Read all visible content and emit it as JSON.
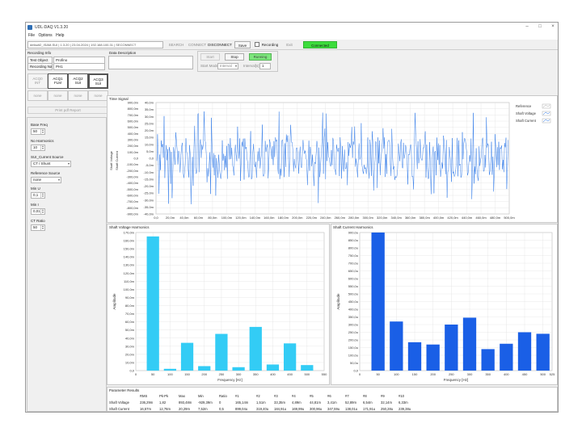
{
  "window": {
    "title": "UDL-DAQ V1.3.20"
  },
  "menu": [
    "File",
    "Options",
    "Help"
  ],
  "toolbar": {
    "device": "default2_ISAM-SUI | 1.3.20 | 23.04.2024 | 192.168.100.31 | SECONNECT",
    "search": "SEARCH",
    "connect": "CONNECT",
    "disconnect": "DISCONNECT",
    "save": "Save",
    "recording": "Recording",
    "exit": "Exit",
    "status": "Connected",
    "status_color": "#3cdc3c"
  },
  "recording_info": {
    "title": "Recording Info",
    "rows": [
      {
        "label": "Test Object",
        "value": "Profino"
      },
      {
        "label": "Recording Name",
        "value": "PH1"
      }
    ]
  },
  "data_description": {
    "title": "Data Description"
  },
  "controls": {
    "start": "Start",
    "stop": "Stop",
    "running": "Running",
    "start_mode_label": "Start Mode",
    "start_mode_value": "Interval",
    "interval_label": "Interval[s]",
    "interval_value": "1"
  },
  "acq_buttons": [
    {
      "line1": "ACQ0",
      "line2": "INT",
      "active": false
    },
    {
      "line1": "ACQ1",
      "line2": "FLM",
      "active": true
    },
    {
      "line1": "ACQ2",
      "line2": "SUI",
      "active": true
    },
    {
      "line1": "ACQ3",
      "line2": "SUI",
      "active": true
    }
  ],
  "acq_none": [
    "none",
    "none",
    "none",
    "none"
  ],
  "print_report": "Print pdf Report",
  "settings": {
    "base_freq_label": "Base Freq",
    "base_freq": "50",
    "no_harmonics_label": "No Harmonics",
    "no_harmonics": "10",
    "sui_source_label": "SUI_Current Source",
    "sui_source": "CT / Shunt",
    "ref_source_label": "Reference Source",
    "ref_source": "none",
    "min_u_label": "Min U",
    "min_u": "0,1",
    "min_i_label": "Min I",
    "min_i": "0,01",
    "ct_ratio_label": "CT Ratio",
    "ct_ratio": "50"
  },
  "time_signal": {
    "title": "Time Signal",
    "ylabel_left": "Shaft Voltage",
    "ylabel_right": "Shaft Current",
    "left_ticks": [
      "900,0m",
      "800,0m",
      "700,0m",
      "600,0m",
      "500,0m",
      "400,0m",
      "300,0m",
      "200,0m",
      "100,0m",
      "0,0",
      "-100,0m",
      "-200,0m",
      "-300,0m",
      "-400,0m",
      "-500,0m",
      "-600,0m",
      "-700,0m",
      "-800,0m",
      "-900,0m"
    ],
    "right_ticks": [
      "40,0m",
      "35,0m",
      "30,0m",
      "25,0m",
      "20,0m",
      "15,0m",
      "10,0m",
      "5,0m",
      "0,0",
      "-5,0m",
      "-10,0m",
      "-15,0m",
      "-20,0m",
      "-25,0m",
      "-30,0m",
      "-35,0m",
      "-40,0m"
    ],
    "x_ticks": [
      "0,0",
      "20,0m",
      "40,0m",
      "60,0m",
      "80,0m",
      "100,0m",
      "120,0m",
      "140,0m",
      "160,0m",
      "180,0m",
      "200,0m",
      "220,0m",
      "240,0m",
      "260,0m",
      "280,0m",
      "300,0m",
      "320,0m",
      "340,0m",
      "360,0m",
      "380,0m",
      "400,0m",
      "420,0m",
      "440,0m",
      "460,0m",
      "480,0m",
      "500,0m"
    ],
    "legend": [
      "Reference",
      "Shaft Voltage",
      "Shaft Current"
    ],
    "line_color": "#1e6ee6"
  },
  "voltage_harmonics": {
    "title": "Shaft Voltage Harmonics",
    "ylabel": "Amplitude",
    "xlabel": "Frequency [Hz]",
    "y_ticks": [
      "170,0m",
      "160,0m",
      "150,0m",
      "140,0m",
      "130,0m",
      "120,0m",
      "110,0m",
      "100,0m",
      "90,0m",
      "80,0m",
      "70,0m",
      "60,0m",
      "50,0m",
      "40,0m",
      "30,0m",
      "20,0m",
      "10,0m",
      "0,0"
    ],
    "x_ticks": [
      "0",
      "50",
      "100",
      "150",
      "200",
      "250",
      "300",
      "350",
      "400",
      "450",
      "500",
      "550"
    ],
    "bar_color": "#33ccf5"
  },
  "current_harmonics": {
    "title": "Shaft Current Harmonics",
    "ylabel": "Amplitude",
    "xlabel": "Frequency [Hz]",
    "y_ticks": [
      "900,0u",
      "850,0u",
      "800,0u",
      "750,0u",
      "700,0u",
      "650,0u",
      "600,0u",
      "550,0u",
      "500,0u",
      "450,0u",
      "400,0u",
      "350,0u",
      "300,0u",
      "250,0u",
      "200,0u",
      "150,0u",
      "100,0u",
      "50,0u",
      "0,0"
    ],
    "x_ticks": [
      "0",
      "50",
      "100",
      "150",
      "200",
      "250",
      "300",
      "350",
      "400",
      "450",
      "500",
      "525"
    ],
    "bar_color": "#1a5fe6"
  },
  "chart_data": [
    {
      "type": "bar",
      "title": "Shaft Voltage Harmonics",
      "xlabel": "Frequency [Hz]",
      "ylabel": "Amplitude",
      "x": [
        50,
        100,
        150,
        200,
        250,
        300,
        350,
        400,
        450,
        500
      ],
      "values": [
        0.1652,
        0.0022,
        0.0342,
        0.0055,
        0.0452,
        0.0042,
        0.0538,
        0.0075,
        0.0335,
        0.0068
      ],
      "xlim": [
        0,
        550
      ],
      "ylim": [
        0,
        0.17
      ],
      "grid": true
    },
    {
      "type": "bar",
      "title": "Shaft Current Harmonics",
      "xlabel": "Frequency [Hz]",
      "ylabel": "Amplitude",
      "x": [
        50,
        100,
        150,
        200,
        250,
        300,
        350,
        400,
        450,
        500
      ],
      "values": [
        0.00091,
        0.00032,
        0.000185,
        0.00017,
        0.0003,
        0.000345,
        0.00014,
        0.000175,
        0.00025,
        0.00024
      ],
      "xlim": [
        0,
        525
      ],
      "ylim": [
        0,
        0.0009
      ],
      "grid": true
    }
  ],
  "parameter_results": {
    "title": "Parameter Results",
    "headers": [
      "",
      "RMS",
      "Pk-Pk",
      "Max",
      "Min",
      "Ratio",
      "#1",
      "#2",
      "#3",
      "#4",
      "#5",
      "#6",
      "#7",
      "#8",
      "#9",
      "#10"
    ],
    "rows": [
      [
        "Shaft Voltage",
        "236,29m",
        "1,82",
        "893,48m",
        "-929,39m",
        "0",
        "165,14m",
        "1,51m",
        "33,35m",
        "4,89m",
        "44,81m",
        "3,41m",
        "52,89m",
        "6,54m",
        "32,14m",
        "6,33m"
      ],
      [
        "Shaft Current",
        "16,57m",
        "12,76m",
        "20,29m",
        "7,52m",
        "0,5",
        "899,04u",
        "319,40u",
        "184,91u",
        "169,99u",
        "300,96u",
        "347,59u",
        "138,01u",
        "171,91u",
        "250,28u",
        "239,38u"
      ]
    ]
  }
}
